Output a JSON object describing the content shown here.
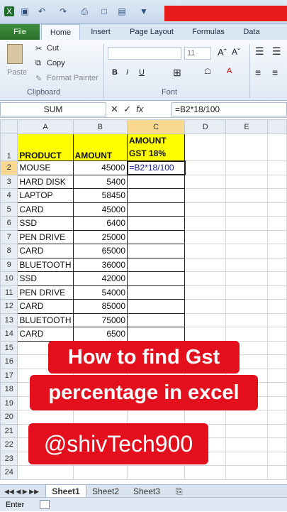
{
  "ribbon_tabs": [
    "File",
    "Home",
    "Insert",
    "Page Layout",
    "Formulas",
    "Data"
  ],
  "clipboard": {
    "cut": "Cut",
    "copy": "Copy",
    "format_painter": "Format Painter",
    "paste": "Paste",
    "group": "Clipboard"
  },
  "font": {
    "size": "11",
    "group": "Font"
  },
  "formula_bar": {
    "name_box": "SUM",
    "formula": "=B2*18/100"
  },
  "columns": [
    "A",
    "B",
    "C",
    "D",
    "E"
  ],
  "rows": [
    {
      "n": "1",
      "a": "PRODUCT",
      "b": "AMOUNT",
      "c1": "AMOUNT",
      "c2": "GST 18%"
    },
    {
      "n": "2",
      "a": "MOUSE",
      "b": "45000",
      "c": "=B2*18/100"
    },
    {
      "n": "3",
      "a": "HARD DISK",
      "b": "5400",
      "c": ""
    },
    {
      "n": "4",
      "a": "LAPTOP",
      "b": "58450",
      "c": ""
    },
    {
      "n": "5",
      "a": "CARD",
      "b": "45000",
      "c": ""
    },
    {
      "n": "6",
      "a": "SSD",
      "b": "6400",
      "c": ""
    },
    {
      "n": "7",
      "a": "PEN DRIVE",
      "b": "25000",
      "c": ""
    },
    {
      "n": "8",
      "a": "CARD",
      "b": "65000",
      "c": ""
    },
    {
      "n": "9",
      "a": "BLUETOOTH",
      "b": "36000",
      "c": ""
    },
    {
      "n": "10",
      "a": "SSD",
      "b": "42000",
      "c": ""
    },
    {
      "n": "11",
      "a": "PEN DRIVE",
      "b": "54000",
      "c": ""
    },
    {
      "n": "12",
      "a": "CARD",
      "b": "85000",
      "c": ""
    },
    {
      "n": "13",
      "a": "BLUETOOTH",
      "b": "75000",
      "c": ""
    },
    {
      "n": "14",
      "a": "CARD",
      "b": "6500",
      "c": ""
    }
  ],
  "empty_rows": [
    "15",
    "16",
    "17",
    "18",
    "19",
    "20",
    "21",
    "22",
    "23",
    "24"
  ],
  "sheets": [
    "Sheet1",
    "Sheet2",
    "Sheet3"
  ],
  "status": "Enter",
  "banner": {
    "line1": "How to find Gst",
    "line2": "percentage in excel",
    "handle": "@shivTech900"
  },
  "colors": {
    "header_fill": "#ffff00",
    "banner": "#e30f1c",
    "file_tab": "#2a6f2a"
  }
}
